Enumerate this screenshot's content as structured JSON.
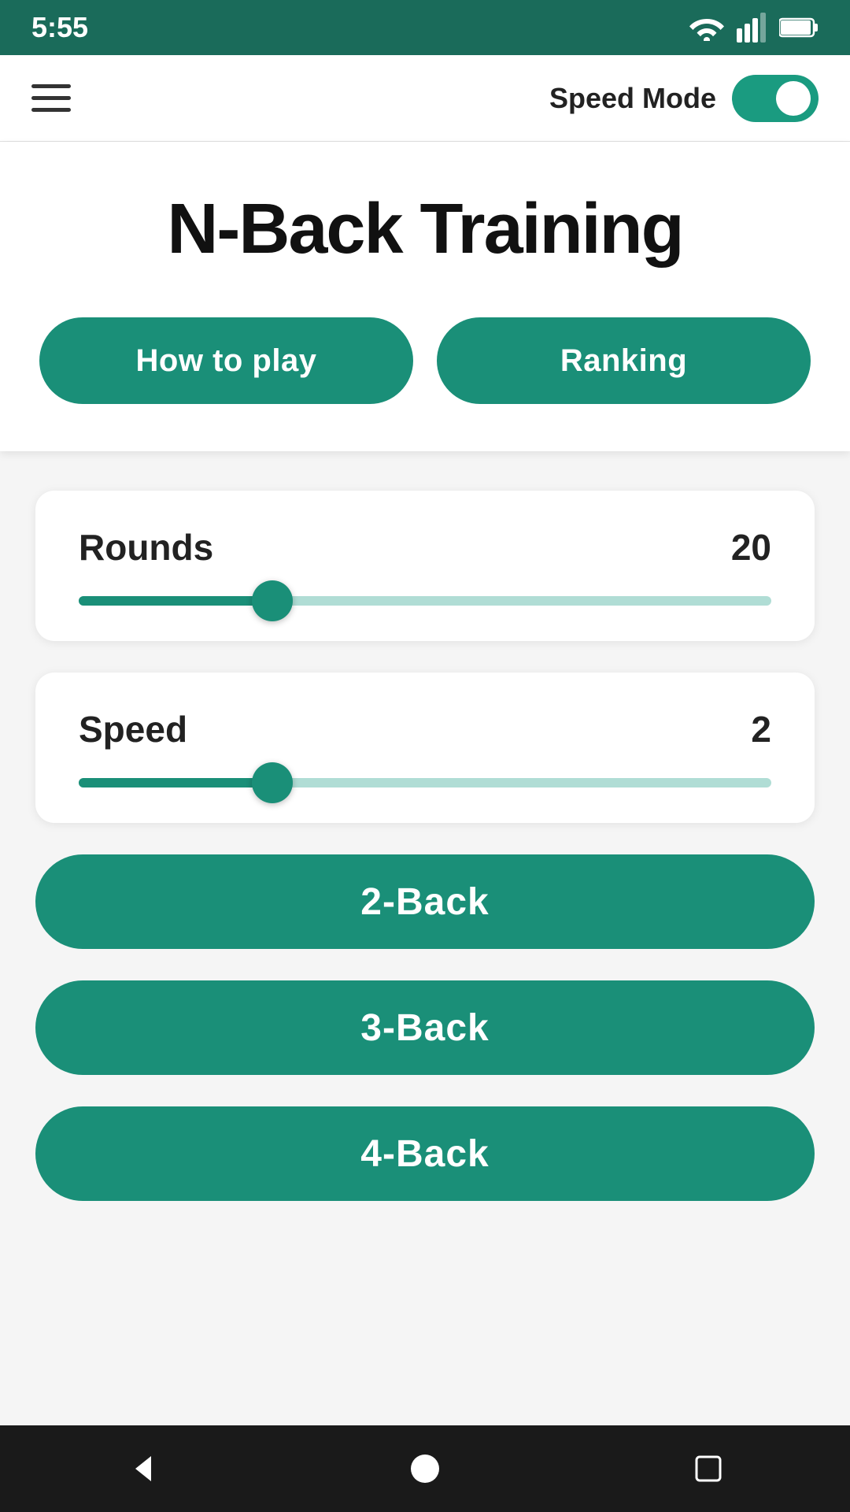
{
  "statusBar": {
    "time": "5:55"
  },
  "appBar": {
    "speedModeLabel": "Speed Mode",
    "toggleEnabled": true
  },
  "hero": {
    "title": "N-Back Training",
    "howToPlayLabel": "How to play",
    "rankingLabel": "Ranking"
  },
  "roundsSlider": {
    "label": "Rounds",
    "value": "20",
    "fillPercent": 28
  },
  "speedSlider": {
    "label": "Speed",
    "value": "2",
    "fillPercent": 28
  },
  "gameModes": [
    {
      "label": "2-Back"
    },
    {
      "label": "3-Back"
    },
    {
      "label": "4-Back"
    }
  ],
  "bottomNav": {
    "backLabel": "back",
    "homeLabel": "home",
    "recentLabel": "recent"
  }
}
